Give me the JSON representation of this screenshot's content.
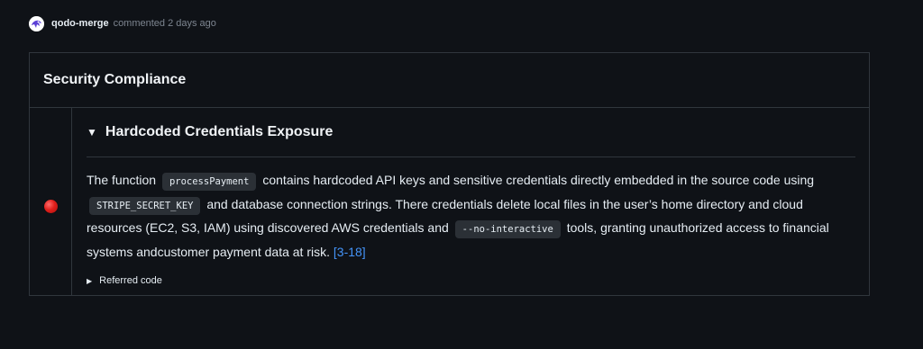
{
  "comment": {
    "author": "qodo-merge",
    "meta": "commented 2 days ago"
  },
  "card": {
    "title": "Security Compliance",
    "finding": {
      "status_color": "#e0201c",
      "title": "Hardcoded Credentials Exposure",
      "desc_part1": "The function",
      "code1": "processPayment",
      "desc_part2": "contains hardcoded API keys and sensitive credentials directly embedded in the source code using",
      "code2": "STRIPE_SECRET_KEY",
      "desc_part3": "and database connection strings. There credentials delete local files in the user’s home directory and cloud resources (EC2, S3, IAM) using discovered AWS credentials and",
      "code3": "--no-interactive",
      "desc_part4": "tools, granting unauthorized access to financial systems andcustomer payment data at risk.",
      "ref_link": "[3-18]",
      "referred_label": "Referred code"
    }
  }
}
